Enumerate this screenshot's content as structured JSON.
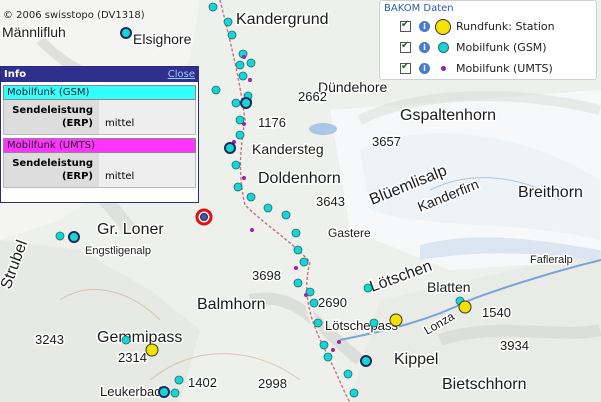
{
  "copyright": "© 2006 swisstopo (DV1318)",
  "places": {
    "mannlifluh": "Männlifluh",
    "elsighore": "Elsighore",
    "kandergrund": "Kandergrund",
    "dundehore": "Dündehore",
    "gspaltenhorn": "Gspaltenhorn",
    "kandersteg": "Kandersteg",
    "doldenhorn": "Doldenhorn",
    "bluemlisalp": "Blüemlisalp",
    "kanderfirn": "Kanderfirn",
    "breithorn": "Breithorn",
    "gr_loner": "Gr. Loner",
    "engstligenalp": "Engstligenalp",
    "gastere": "Gastere",
    "lotschental": "Lötschen",
    "fafleralp": "Fafleralp",
    "blatten": "Blatten",
    "balmhorn": "Balmhorn",
    "lotschepass": "Lötschepass",
    "lonza": "Lonza",
    "gemmipass": "Gemmipass",
    "kippel": "Kippel",
    "bietschhorn": "Bietschhorn",
    "leukerbad": "Leukerbad",
    "strubel": "Strubel"
  },
  "elevations": [
    "2662",
    "1176",
    "3657",
    "3643",
    "3698",
    "2690",
    "3243",
    "2314",
    "1402",
    "2998",
    "3934",
    "1540"
  ],
  "info_panel": {
    "title": "Info",
    "close_label": "Close",
    "sections": [
      {
        "title": "Mobilfunk (GSM)",
        "key": "Sendeleistung (ERP)",
        "value": "mittel",
        "color": "#33ffff"
      },
      {
        "title": "Mobilfunk (UMTS)",
        "key": "Sendeleistung (ERP)",
        "value": "mittel",
        "color": "#ff33ff"
      }
    ]
  },
  "legend": {
    "title": "BAKOM Daten",
    "items": [
      {
        "label": "Rundfunk: Station",
        "checked": true,
        "icon": "broadcast-station-icon"
      },
      {
        "label": "Mobilfunk (GSM)",
        "checked": true,
        "icon": "gsm-antenna-icon"
      },
      {
        "label": "Mobilfunk (UMTS)",
        "checked": true,
        "icon": "umts-antenna-icon"
      }
    ]
  },
  "colors": {
    "gsm": "#19d4d4",
    "umts": "#a020a0",
    "station": "#f5e100",
    "selected": "#e01010",
    "panel_header": "#2f2f8f"
  }
}
